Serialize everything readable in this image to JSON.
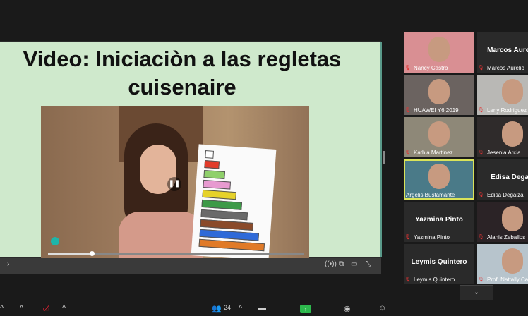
{
  "slide": {
    "title_line1": "Video: Iniciaciòn a las regletas",
    "title_line2": "cuisenaire"
  },
  "video": {
    "pause_icon": "❚❚",
    "progress": 0.17,
    "rods": [
      "#ffffff",
      "#e23b2a",
      "#8fd06a",
      "#e79ad0",
      "#e6d22a",
      "#3d9a47",
      "#6a6a6a",
      "#8a4a2a",
      "#2f6ad8",
      "#e07a28"
    ]
  },
  "participants": [
    {
      "name": "Nancy Castro",
      "mic_muted": true,
      "video": true,
      "bg": "#d98f93"
    },
    {
      "name": "Marcos  Aurelio",
      "label": "Marcos Aurelio",
      "mic_muted": true,
      "video": false
    },
    {
      "name": "HUAWEI Y6 2019",
      "mic_muted": true,
      "video": true,
      "bg": "#6b6360"
    },
    {
      "name": "Leny Rodriguez",
      "mic_muted": true,
      "video": true,
      "bg": "#b9b8b5"
    },
    {
      "name": "Kathia Martinez",
      "mic_muted": true,
      "video": true,
      "bg": "#8e8878"
    },
    {
      "name": "Jesenia Arcia",
      "mic_muted": true,
      "video": true,
      "bg": "#2f2b2b"
    },
    {
      "name": "Argelis Bustamante",
      "mic_muted": false,
      "video": true,
      "bg": "#4a7a88",
      "active": true
    },
    {
      "name": "Edisa Degaiz",
      "label": "Edisa Degaiza",
      "mic_muted": true,
      "video": false
    },
    {
      "name": "Yazmina Pinto",
      "label": "Yazmina Pinto",
      "mic_muted": true,
      "video": false
    },
    {
      "name": "Alanis Zeballos",
      "mic_muted": true,
      "video": true,
      "bg": "#2b2326"
    },
    {
      "name": "Leymis Quintero",
      "label": "Leymis Quintero",
      "mic_muted": true,
      "video": false
    },
    {
      "name": "Prof. Nattally Ca",
      "mic_muted": true,
      "video": true,
      "bg": "#b7c4cc"
    }
  ],
  "toolbar": {
    "participants_count": "24",
    "chevron": "^",
    "share_icon": "↑",
    "scroll_down": "⌄"
  },
  "colors": {
    "slide_bg": "#cfe9cc",
    "active_border": "#d9e35a",
    "share_green": "#2db84d",
    "muted_red": "#e23333"
  }
}
